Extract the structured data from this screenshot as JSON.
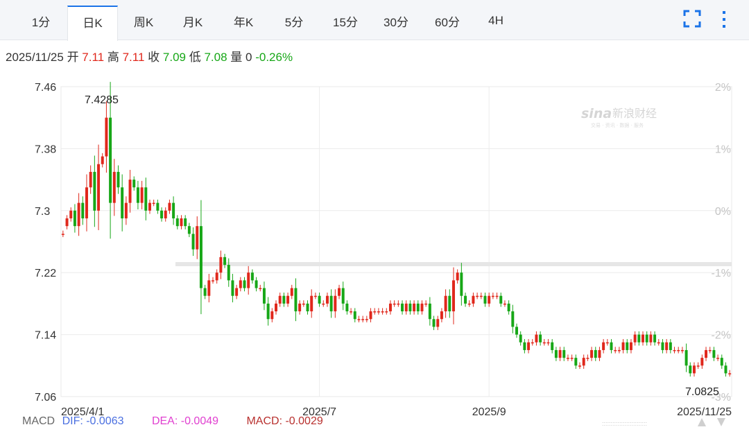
{
  "tabs": [
    {
      "label": "1分",
      "name": "tab-1min"
    },
    {
      "label": "日K",
      "name": "tab-daily-k",
      "active": true
    },
    {
      "label": "周K",
      "name": "tab-weekly-k"
    },
    {
      "label": "月K",
      "name": "tab-monthly-k"
    },
    {
      "label": "年K",
      "name": "tab-yearly-k"
    },
    {
      "label": "5分",
      "name": "tab-5min"
    },
    {
      "label": "15分",
      "name": "tab-15min"
    },
    {
      "label": "30分",
      "name": "tab-30min"
    },
    {
      "label": "60分",
      "name": "tab-60min"
    },
    {
      "label": "4H",
      "name": "tab-4h"
    }
  ],
  "toolbar": {
    "fullscreen_icon": "fullscreen-icon",
    "more_icon": "more-vertical-icon",
    "accent_color": "#1a73e8"
  },
  "quote": {
    "date": "2025/11/25",
    "open_label": "开",
    "open": "7.11",
    "high_label": "高",
    "high": "7.11",
    "close_label": "收",
    "close": "7.09",
    "low_label": "低",
    "low": "7.08",
    "volume_label": "量",
    "volume": "0",
    "change_pct": "-0.26%"
  },
  "macd": {
    "label": "MACD",
    "dif": "DIF: -0.0063",
    "dea": "DEA: -0.0049",
    "macd": "MACD: -0.0029"
  },
  "colors": {
    "up": "#e0271b",
    "down": "#17a717",
    "dif": "#4a6fe0",
    "dea": "#e040d0",
    "macd": "#b8302e"
  },
  "chart_data": {
    "type": "candlestick",
    "y_ticks": [
      "7.46",
      "7.38",
      "7.3",
      "7.22",
      "7.14",
      "7.06"
    ],
    "ylim": [
      7.06,
      7.46
    ],
    "pct_ticks": [
      "2%",
      "1%",
      "0%",
      "-1%",
      "-2%",
      "-3%"
    ],
    "pct_range": [
      -3,
      2
    ],
    "base_close": 7.2279,
    "x_labels": [
      {
        "label": "2025/4/1",
        "index": 4
      },
      {
        "label": "2025/7",
        "index": 65
      },
      {
        "label": "2025/9",
        "index": 108
      },
      {
        "label": "2025/11/25",
        "index": 167
      }
    ],
    "high_annotation": "7.4285",
    "low_annotation": "7.0825",
    "grid": true,
    "close": [
      7.27,
      7.29,
      7.3,
      7.28,
      7.31,
      7.29,
      7.33,
      7.35,
      7.3,
      7.36,
      7.37,
      7.42,
      7.31,
      7.35,
      7.33,
      7.29,
      7.31,
      7.34,
      7.33,
      7.31,
      7.33,
      7.3,
      7.31,
      7.31,
      7.3,
      7.29,
      7.3,
      7.31,
      7.29,
      7.28,
      7.29,
      7.28,
      7.27,
      7.25,
      7.28,
      7.2,
      7.19,
      7.21,
      7.21,
      7.22,
      7.24,
      7.23,
      7.21,
      7.19,
      7.2,
      7.21,
      7.2,
      7.22,
      7.21,
      7.2,
      7.2,
      7.18,
      7.16,
      7.17,
      7.18,
      7.19,
      7.18,
      7.19,
      7.2,
      7.17,
      7.18,
      7.18,
      7.17,
      7.19,
      7.19,
      7.18,
      7.18,
      7.19,
      7.17,
      7.19,
      7.2,
      7.18,
      7.17,
      7.17,
      7.16,
      7.16,
      7.16,
      7.16,
      7.17,
      7.17,
      7.17,
      7.17,
      7.17,
      7.18,
      7.18,
      7.18,
      7.17,
      7.18,
      7.17,
      7.18,
      7.17,
      7.18,
      7.18,
      7.16,
      7.15,
      7.16,
      7.17,
      7.19,
      7.17,
      7.21,
      7.22,
      7.19,
      7.18,
      7.18,
      7.19,
      7.19,
      7.19,
      7.18,
      7.19,
      7.19,
      7.19,
      7.18,
      7.18,
      7.17,
      7.15,
      7.14,
      7.13,
      7.12,
      7.13,
      7.13,
      7.14,
      7.13,
      7.13,
      7.13,
      7.12,
      7.11,
      7.12,
      7.11,
      7.11,
      7.11,
      7.1,
      7.1,
      7.11,
      7.11,
      7.12,
      7.11,
      7.12,
      7.13,
      7.13,
      7.12,
      7.12,
      7.12,
      7.13,
      7.12,
      7.13,
      7.14,
      7.13,
      7.14,
      7.13,
      7.14,
      7.13,
      7.13,
      7.12,
      7.13,
      7.12,
      7.12,
      7.12,
      7.12,
      7.1,
      7.09,
      7.1,
      7.1,
      7.11,
      7.12,
      7.12,
      7.11,
      7.11,
      7.1,
      7.09,
      7.09
    ],
    "open": [
      7.27,
      7.28,
      7.29,
      7.3,
      7.28,
      7.31,
      7.29,
      7.33,
      7.35,
      7.3,
      7.36,
      7.37,
      7.42,
      7.31,
      7.35,
      7.33,
      7.29,
      7.31,
      7.34,
      7.33,
      7.31,
      7.33,
      7.3,
      7.31,
      7.31,
      7.3,
      7.29,
      7.3,
      7.31,
      7.29,
      7.28,
      7.29,
      7.28,
      7.27,
      7.25,
      7.28,
      7.2,
      7.19,
      7.21,
      7.21,
      7.22,
      7.24,
      7.23,
      7.21,
      7.19,
      7.2,
      7.21,
      7.2,
      7.22,
      7.21,
      7.2,
      7.2,
      7.18,
      7.16,
      7.17,
      7.18,
      7.19,
      7.18,
      7.19,
      7.2,
      7.17,
      7.18,
      7.18,
      7.17,
      7.19,
      7.19,
      7.18,
      7.18,
      7.19,
      7.17,
      7.19,
      7.2,
      7.18,
      7.17,
      7.17,
      7.16,
      7.16,
      7.16,
      7.16,
      7.17,
      7.17,
      7.17,
      7.17,
      7.17,
      7.18,
      7.18,
      7.18,
      7.17,
      7.18,
      7.17,
      7.18,
      7.17,
      7.18,
      7.18,
      7.16,
      7.15,
      7.16,
      7.17,
      7.19,
      7.17,
      7.21,
      7.22,
      7.19,
      7.18,
      7.18,
      7.19,
      7.19,
      7.19,
      7.18,
      7.19,
      7.19,
      7.19,
      7.18,
      7.18,
      7.17,
      7.15,
      7.14,
      7.13,
      7.12,
      7.13,
      7.13,
      7.14,
      7.13,
      7.13,
      7.13,
      7.12,
      7.11,
      7.12,
      7.11,
      7.11,
      7.11,
      7.1,
      7.1,
      7.11,
      7.11,
      7.12,
      7.11,
      7.12,
      7.13,
      7.13,
      7.12,
      7.12,
      7.12,
      7.13,
      7.12,
      7.13,
      7.14,
      7.13,
      7.14,
      7.13,
      7.14,
      7.13,
      7.13,
      7.12,
      7.13,
      7.12,
      7.12,
      7.12,
      7.12,
      7.1,
      7.09,
      7.1,
      7.1,
      7.11,
      7.12,
      7.12,
      7.11,
      7.11,
      7.1,
      7.09
    ]
  }
}
